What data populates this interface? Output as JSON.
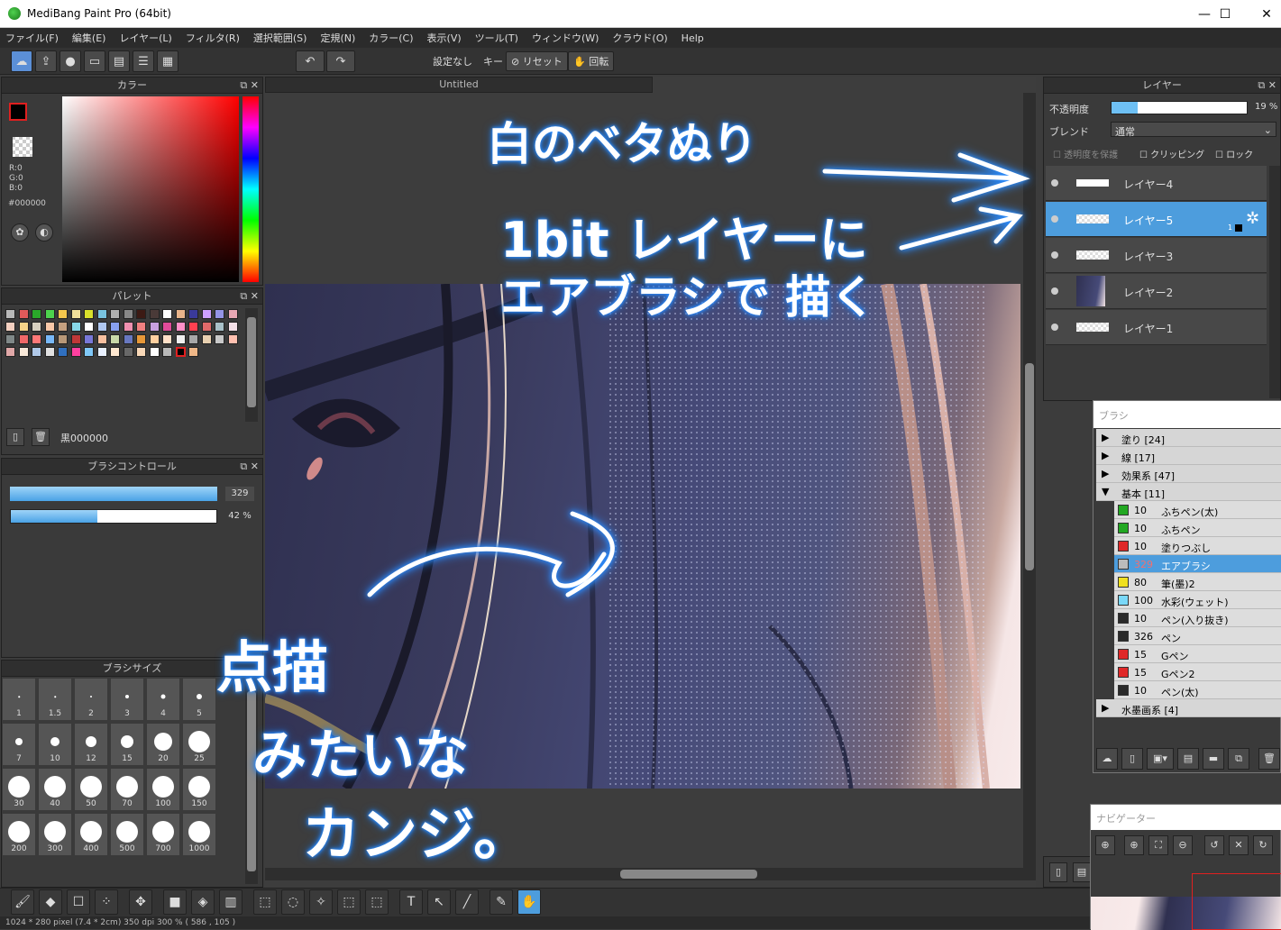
{
  "title": "MediBang Paint Pro (64bit)",
  "window_controls": {
    "min": "—",
    "max": "☐",
    "close": "✕"
  },
  "menu": [
    "ファイル(F)",
    "編集(E)",
    "レイヤー(L)",
    "フィルタ(R)",
    "選択範囲(S)",
    "定規(N)",
    "カラー(C)",
    "表示(V)",
    "ツール(T)",
    "ウィンドウ(W)",
    "クラウド(O)",
    "Help"
  ],
  "toolbar": {
    "settings": "設定なし",
    "key": "キー",
    "reset": "リセット",
    "rotate": "回転"
  },
  "canvas": {
    "tab": "Untitled"
  },
  "color_panel": {
    "title": "カラー",
    "r": "R:0",
    "g": "G:0",
    "b": "B:0",
    "hex": "#000000"
  },
  "palette": {
    "title": "パレット",
    "selected_name": "黒000000",
    "colors": [
      "#b8b8b8",
      "#e05a5a",
      "#2aa82a",
      "#4dd44d",
      "#f3c64d",
      "#f1df9a",
      "#d8e02b",
      "#78c3e0",
      "#b0b0b0",
      "#888888",
      "#3c1a14",
      "#4a3a38",
      "#ffffff",
      "#e8b48a",
      "#3a3a9a",
      "#cda0ff",
      "#9494e6",
      "#e8a7b4",
      "#f4d0c0",
      "#f7d488",
      "#d8d0c0",
      "#f8c8a8",
      "#c4a080",
      "#88d8e8",
      "#ffffff",
      "#b0c8f0",
      "#88a0f0",
      "#f090b0",
      "#f08080",
      "#c8a0e0",
      "#e04b9a",
      "#ff90c8",
      "#ff4050",
      "#e06a6a",
      "#a8c0c8",
      "#f4e0e8",
      "#808888",
      "#f06868",
      "#ff7878",
      "#78b8f8",
      "#b89878",
      "#c03838",
      "#7878d8",
      "#f8c0a0",
      "#c8d8a8",
      "#6878c0",
      "#e89838",
      "#ffd0a0",
      "#ffe0c8",
      "#f0f0f0",
      "#a8a8a8",
      "#e8d0b0",
      "#c8c8c8",
      "#ffc0b0",
      "#e0a8a8",
      "#f8e8d8",
      "#b0c8e8",
      "#e0e0e0",
      "#3070c0",
      "#ff40a0",
      "#80c8f8",
      "#e8f0ff",
      "#ffe8d0",
      "#686868",
      "#f8d8b8",
      "#ffffff",
      "#b8b8b8",
      "#000000",
      "#f0b888"
    ]
  },
  "brush_control": {
    "title": "ブラシコントロール",
    "size_value": "329",
    "opacity_value": "42 %",
    "opacity_fraction": 0.42
  },
  "brush_size": {
    "title": "ブラシサイズ",
    "sizes": [
      "1",
      "1.5",
      "2",
      "3",
      "4",
      "5",
      "7",
      "10",
      "12",
      "15",
      "20",
      "25",
      "30",
      "40",
      "50",
      "70",
      "100",
      "150",
      "200",
      "300",
      "400",
      "500",
      "700",
      "1000"
    ]
  },
  "layer_panel": {
    "title": "レイヤー",
    "opacity_label": "不透明度",
    "opacity_value": "19 %",
    "opacity_fraction": 0.19,
    "blend_label": "ブレンド",
    "blend_value": "通常",
    "protect_label": "透明度を保護",
    "clip_label": "クリッピング",
    "lock_label": "ロック",
    "layers": [
      {
        "name": "レイヤー4"
      },
      {
        "name": "レイヤー5",
        "badge": "1"
      },
      {
        "name": "レイヤー3"
      },
      {
        "name": "レイヤー2"
      },
      {
        "name": "レイヤー1"
      }
    ]
  },
  "brush_panel": {
    "title": "ブラシ",
    "rows": [
      {
        "type": "cat",
        "arrow": "▶",
        "label": "塗り [24]"
      },
      {
        "type": "cat",
        "arrow": "▶",
        "label": "線 [17]"
      },
      {
        "type": "cat",
        "arrow": "▶",
        "label": "効果系 [47]"
      },
      {
        "type": "cat",
        "arrow": "▼",
        "label": "基本 [11]"
      },
      {
        "type": "item",
        "color": "#22a822",
        "size": "10",
        "label": "ふちペン(太)"
      },
      {
        "type": "item",
        "color": "#22a822",
        "size": "10",
        "label": "ふちペン"
      },
      {
        "type": "item",
        "color": "#e02828",
        "size": "10",
        "label": "塗りつぶし"
      },
      {
        "type": "item",
        "color": "#bbbbbb",
        "size": "329",
        "label": "エアブラシ",
        "selected": true
      },
      {
        "type": "item",
        "color": "#f0e020",
        "size": "80",
        "label": "筆(墨)2"
      },
      {
        "type": "item",
        "color": "#7ad8f8",
        "size": "100",
        "label": "水彩(ウェット)"
      },
      {
        "type": "item",
        "color": "#2a2a2a",
        "size": "10",
        "label": "ペン(入り抜き)"
      },
      {
        "type": "item",
        "color": "#2a2a2a",
        "size": "326",
        "label": "ペン"
      },
      {
        "type": "item",
        "color": "#e02828",
        "size": "15",
        "label": "Gペン"
      },
      {
        "type": "item",
        "color": "#e02828",
        "size": "15",
        "label": "Gペン2"
      },
      {
        "type": "item",
        "color": "#2a2a2a",
        "size": "10",
        "label": "ペン(太)"
      },
      {
        "type": "cat",
        "arrow": "▶",
        "label": "水墨画系 [4]"
      }
    ]
  },
  "navigator": {
    "title": "ナビゲーター"
  },
  "status": "1024 * 280 pixel   (7.4 * 2cm)   350 dpi   300 %   ( 586 , 105 )",
  "annotations": {
    "line1": "白のベタぬり",
    "line2": "1bit レイヤーに",
    "line3": "エアブラシで 描く",
    "line4": "点描",
    "line5": "みたいな",
    "line6": "カンジ。"
  }
}
